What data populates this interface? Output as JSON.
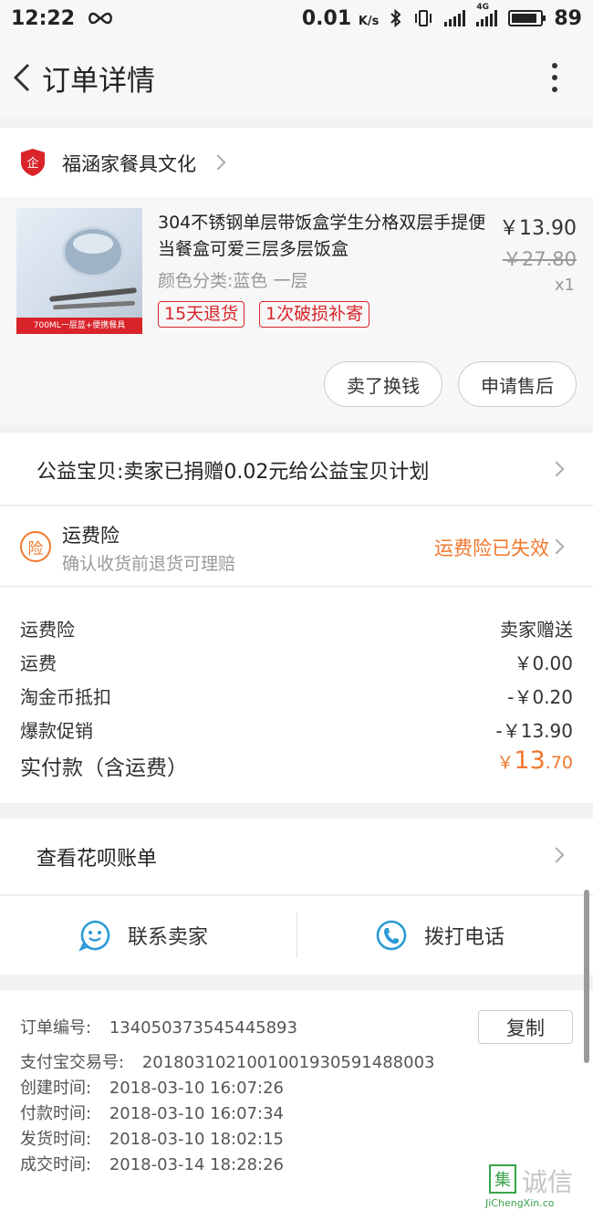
{
  "status_bar": {
    "time": "12:22",
    "speed": "0.01",
    "speed_unit": "K/s",
    "network": "4G",
    "battery": "89",
    "battery_level": 0.89
  },
  "header": {
    "title": "订单详情"
  },
  "shop": {
    "badge": "企",
    "name": "福涵家餐具文化"
  },
  "product": {
    "thumb_caption": "700ML一层蓝+便携餐具",
    "name": "304不锈钢单层带饭盒学生分格双层手提便当餐盒可爱三层多层饭盒",
    "price": "￥13.90",
    "original_price": "￥27.80",
    "quantity": "x1",
    "spec": "颜色分类:蓝色 一层",
    "tags": [
      "15天退货",
      "1次破损补寄"
    ],
    "buttons": {
      "resell": "卖了换钱",
      "after_sale": "申请售后"
    }
  },
  "charity": {
    "text": "公益宝贝:卖家已捐赠0.02元给公益宝贝计划"
  },
  "shipping_insurance": {
    "icon": "险",
    "title": "运费险",
    "subtitle": "确认收货前退货可理赔",
    "status": "运费险已失效"
  },
  "fees": [
    {
      "label": "运费险",
      "value": "卖家赠送"
    },
    {
      "label": "运费",
      "value": "￥0.00"
    },
    {
      "label": "淘金币抵扣",
      "value": "-￥0.20"
    },
    {
      "label": "爆款促销",
      "value": "-￥13.90"
    }
  ],
  "total": {
    "label": "实付款（含运费）",
    "currency": "￥",
    "integer": "13",
    "decimal": ".70"
  },
  "huabei": {
    "text": "查看花呗账单"
  },
  "contact": {
    "seller": "联系卖家",
    "phone": "拨打电话"
  },
  "order_info": {
    "copy_label": "复制",
    "rows": [
      {
        "label": "订单编号:",
        "value": "134050373545445893"
      },
      {
        "label": "支付宝交易号:",
        "value": "2018031021001001930591488003"
      },
      {
        "label": "创建时间:",
        "value": "2018-03-10 16:07:26"
      },
      {
        "label": "付款时间:",
        "value": "2018-03-10 16:07:34"
      },
      {
        "label": "发货时间:",
        "value": "2018-03-10 18:02:15"
      },
      {
        "label": "成交时间:",
        "value": "2018-03-14 18:28:26"
      }
    ]
  },
  "watermark": {
    "chars": "集诚信",
    "url": "JiChengXin.co"
  },
  "colors": {
    "accent_orange": "#f0782d",
    "tag_red": "#d9242a",
    "contact_blue": "#2a9ad6"
  }
}
